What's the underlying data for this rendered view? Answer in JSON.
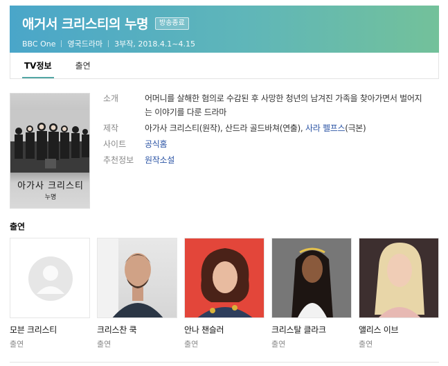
{
  "header": {
    "title": "애거서 크리스티의 누명",
    "status_badge": "방송종료",
    "broadcaster": "BBC One",
    "genre": "영국드라마",
    "episodes_dates": "3부작, 2018.4.1~4.15",
    "gradient_start": "#4aa6c9",
    "gradient_end": "#73c19a"
  },
  "tabs": [
    {
      "label": "TV정보",
      "active": true
    },
    {
      "label": "출연",
      "active": false
    }
  ],
  "poster": {
    "title": "아가사 크리스티",
    "subtitle": "누명"
  },
  "info": {
    "synopsis_label": "소개",
    "synopsis": "어머니를 살해한 혐의로 수감된 후 사망한 청년의 남겨진 가족을 찾아가면서 벌어지는 이야기를 다룬 드라마",
    "production_label": "제작",
    "production": {
      "author": "아가사 크리스티",
      "author_role": "(원작), ",
      "director": "산드라 골드바쳐",
      "director_role": "(연출), ",
      "writer": "사라 펠프스",
      "writer_role": "(극본)"
    },
    "site_label": "사이트",
    "site": "공식홈",
    "recommend_label": "추천정보",
    "recommend": "원작소설"
  },
  "cast_heading": "출연",
  "cast": [
    {
      "name": "모븐 크리스티",
      "role": "출연",
      "photo": "placeholder-avatar"
    },
    {
      "name": "크리스찬 쿡",
      "role": "출연",
      "photo": "person"
    },
    {
      "name": "안나 챈슬러",
      "role": "출연",
      "photo": "person"
    },
    {
      "name": "크리스탈 클라크",
      "role": "출연",
      "photo": "person"
    },
    {
      "name": "앨리스 이브",
      "role": "출연",
      "photo": "person"
    }
  ],
  "colors": {
    "link": "#2a53a4",
    "tab_indicator": "#52a6a4"
  }
}
